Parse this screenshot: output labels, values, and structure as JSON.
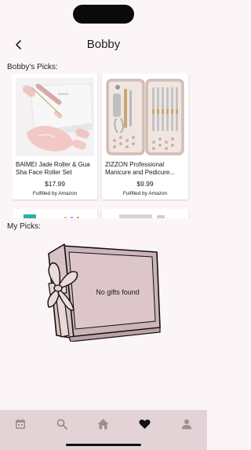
{
  "header": {
    "title": "Bobby"
  },
  "friend_picks": {
    "label": "Bobby's Picks:",
    "items": [
      {
        "name": "BAIMEI Jade Roller & Gua Sha Face Roller Set",
        "price": "$17.99",
        "fulfilled": "Fulfilled by Amazon",
        "image_brand_text": "BAIMEI"
      },
      {
        "name": "ZIZZON Professional Manicure and Pedicure...",
        "price": "$9.99",
        "fulfilled": "Fulfilled by Amazon"
      }
    ]
  },
  "my_picks": {
    "label": "My Picks:",
    "empty_message": "No gifts found"
  },
  "tabbar": {
    "tabs": [
      {
        "icon": "calendar-icon",
        "active": false
      },
      {
        "icon": "search-icon",
        "active": false
      },
      {
        "icon": "home-icon",
        "active": false
      },
      {
        "icon": "heart-icon",
        "active": true
      },
      {
        "icon": "person-icon",
        "active": false
      }
    ]
  },
  "colors": {
    "background": "#fbf5f8",
    "tabbar": "#e3d3d6",
    "tab_icon_inactive": "#a28b8f",
    "tab_icon_active": "#111111",
    "gift_box": "#dcc6c9"
  }
}
